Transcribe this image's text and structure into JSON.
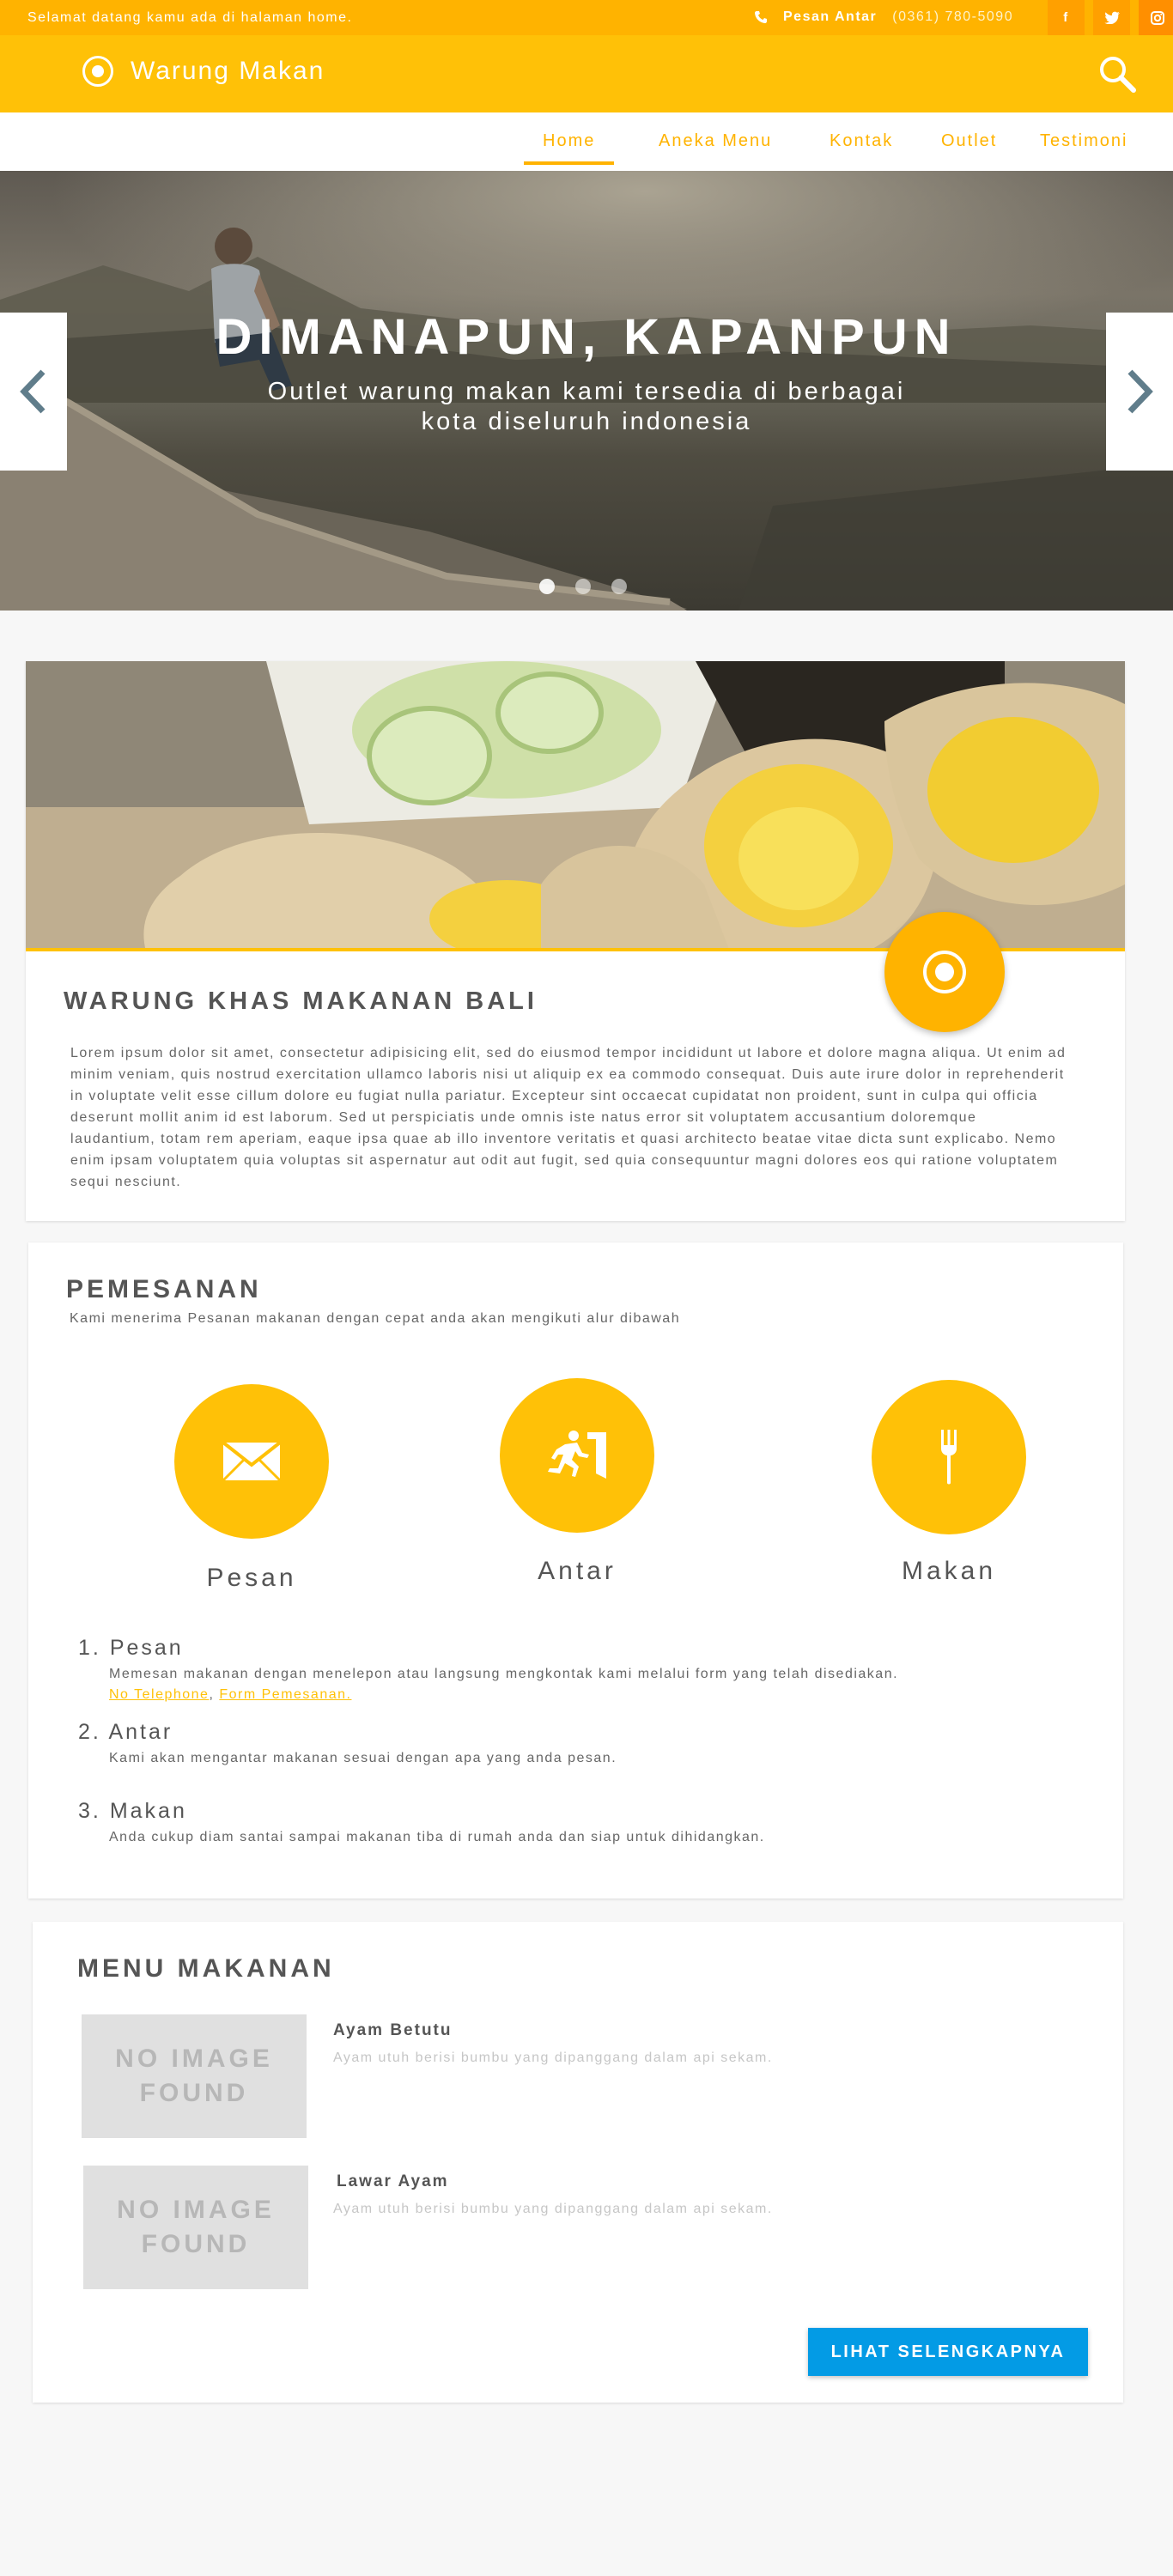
{
  "topbar": {
    "welcome": "Selamat datang kamu ada di halaman home.",
    "phone_label": "Pesan Antar",
    "phone_number": "(0361) 780-5090",
    "social": [
      {
        "name": "facebook-icon",
        "glyph": "f"
      },
      {
        "name": "twitter-icon",
        "glyph": "t"
      },
      {
        "name": "instagram-icon",
        "glyph": "◎"
      }
    ]
  },
  "header": {
    "brand": "Warung Makan"
  },
  "nav": {
    "items": [
      {
        "label": "Home",
        "active": true
      },
      {
        "label": "Aneka Menu"
      },
      {
        "label": "Kontak"
      },
      {
        "label": "Outlet"
      },
      {
        "label": "Testimoni"
      }
    ]
  },
  "hero": {
    "title": "DIMANAPUN, KAPANPUN",
    "subtitle": "Outlet warung makan kami tersedia di berbagai kota diseluruh indonesia",
    "slides": 3,
    "active_slide": 1
  },
  "about": {
    "title": "WARUNG KHAS MAKANAN BALI",
    "text": "Lorem ipsum dolor sit amet, consectetur adipisicing elit, sed do eiusmod tempor incididunt ut labore et dolore magna aliqua. Ut enim ad minim veniam, quis nostrud exercitation ullamco laboris nisi ut aliquip ex ea commodo consequat. Duis aute irure dolor in reprehenderit in voluptate velit esse cillum dolore eu fugiat nulla pariatur. Excepteur sint occaecat cupidatat non proident, sunt in culpa qui officia deserunt mollit anim id est laborum. Sed ut perspiciatis unde omnis iste natus error sit voluptatem accusantium doloremque laudantium, totam rem aperiam, eaque ipsa quae ab illo inventore veritatis et quasi architecto beatae vitae dicta sunt explicabo. Nemo enim ipsam voluptatem quia voluptas sit aspernatur aut odit aut fugit, sed quia consequuntur magni dolores eos qui ratione voluptatem sequi nesciunt."
  },
  "order": {
    "title": "PEMESANAN",
    "subtitle": "Kami menerima Pesanan makanan dengan cepat anda akan mengikuti alur dibawah",
    "steps": [
      {
        "label": "Pesan",
        "icon": "envelope-icon"
      },
      {
        "label": "Antar",
        "icon": "running-exit-icon"
      },
      {
        "label": "Makan",
        "icon": "fork-icon"
      }
    ],
    "list": [
      {
        "num": "1.",
        "title": "Pesan",
        "desc": "Memesan makanan dengan menelepon atau langsung mengkontak kami melalui form yang telah disediakan.",
        "link1": "No Telephone",
        "sep": ", ",
        "link2": "Form Pemesanan."
      },
      {
        "num": "2.",
        "title": "Antar",
        "desc": "Kami akan mengantar makanan sesuai dengan apa yang anda pesan."
      },
      {
        "num": "3.",
        "title": "Makan",
        "desc": "Anda cukup diam santai sampai makanan tiba di rumah anda dan siap untuk dihidangkan."
      }
    ]
  },
  "menu": {
    "title": "MENU MAKANAN",
    "items": [
      {
        "thumb": "NO IMAGE FOUND",
        "name": "Ayam Betutu",
        "desc": "Ayam utuh berisi bumbu yang dipanggang dalam api sekam."
      },
      {
        "thumb": "NO IMAGE FOUND",
        "name": "Lawar Ayam",
        "desc": "Ayam utuh berisi bumbu yang dipanggang dalam api sekam."
      }
    ],
    "more_button": "LIHAT SELENGKAPNYA"
  },
  "colors": {
    "accent": "#ffc107",
    "accent_dark": "#ffb300",
    "button_blue": "#039be5",
    "background": "#f7f7f7"
  }
}
